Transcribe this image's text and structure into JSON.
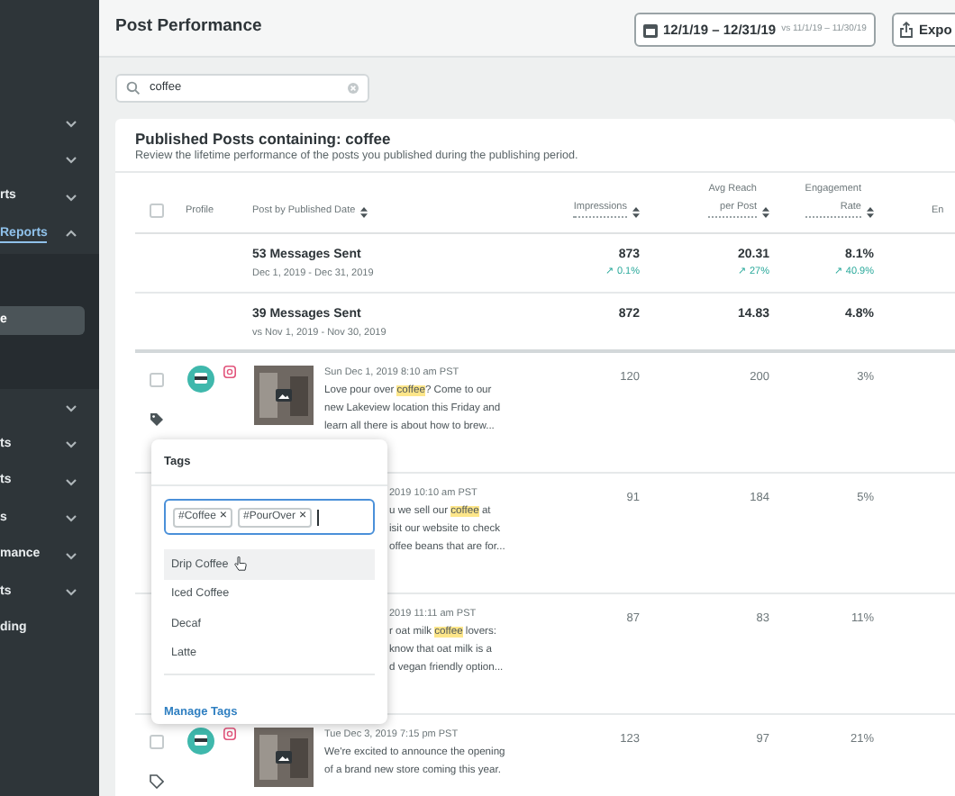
{
  "sidebar": {
    "items": [
      {
        "expanded": false
      },
      {
        "expanded": false
      },
      {
        "label": "rts",
        "expanded": false
      },
      {
        "label": "Reports",
        "expanded": true,
        "children": [
          {
            "label": "e",
            "selected": true
          }
        ]
      },
      {
        "expanded": false
      },
      {
        "label": "ts",
        "expanded": false
      },
      {
        "label": "ts",
        "expanded": false
      },
      {
        "label": "s",
        "expanded": false
      },
      {
        "label": "mance",
        "expanded": false
      },
      {
        "label": "ts",
        "expanded": false
      },
      {
        "label": "ding"
      }
    ]
  },
  "header": {
    "title": "Post Performance",
    "date_range": {
      "range": "12/1/19 – 12/31/19",
      "compare": "vs 11/1/19 – 11/30/19"
    },
    "export_button": "Expo"
  },
  "search": {
    "value": "coffee"
  },
  "card": {
    "title": "Published Posts containing: coffee",
    "subtitle": "Review the lifetime performance of the posts you published during the publishing period."
  },
  "table": {
    "select_all": {
      "checked": false
    },
    "columns": [
      "Profile",
      "Post by Published Date",
      "Impressions",
      "Avg Reach\nper Post",
      "Engagement\nRate",
      "En"
    ],
    "summary_rows": [
      {
        "title": "53 Messages Sent",
        "dates": "Dec 1, 2019 - Dec 31, 2019",
        "values": [
          {
            "value": "873",
            "change": "↗ 0.1%"
          },
          {
            "value": "20.31",
            "change": "↗ 27%"
          },
          {
            "value": "8.1%",
            "change": "↗ 40.9%"
          }
        ]
      },
      {
        "title": "39 Messages Sent",
        "dates": "vs Nov 1, 2019 - Nov 30, 2019",
        "values": [
          {
            "value": "872"
          },
          {
            "value": "14.83"
          },
          {
            "value": "4.8%"
          }
        ]
      }
    ],
    "rows": [
      {
        "kind": "full",
        "checked": false,
        "tagged": true,
        "date": "Sun Dec 1, 2019 8:10 am PST",
        "body": [
          {
            "text": "Love pour over ",
            "highlighted": false
          },
          {
            "text": "coffee",
            "highlighted": true
          },
          {
            "text": "? Come to our\nnew Lakeview location this Friday and\nlearn all there is about how to brew...",
            "highlighted": false
          }
        ],
        "values": [
          "120",
          "200",
          "3%"
        ]
      },
      {
        "kind": "covered",
        "date": "2019 10:10 am PST",
        "body": [
          {
            "text": "u we sell our ",
            "highlighted": false
          },
          {
            "text": "coffee",
            "highlighted": true
          },
          {
            "text": " at\nisit our website to check\noffee beans that are for...",
            "highlighted": false
          }
        ],
        "values": [
          "91",
          "184",
          "5%"
        ]
      },
      {
        "kind": "covered",
        "date": "2019 11:11 am PST",
        "body": [
          {
            "text": "r oat milk ",
            "highlighted": false
          },
          {
            "text": "coffee",
            "highlighted": true
          },
          {
            "text": " lovers:\nknow that oat milk is a\nd vegan friendly option...",
            "highlighted": false
          }
        ],
        "values": [
          "87",
          "83",
          "11%"
        ]
      },
      {
        "kind": "full",
        "checked": false,
        "tagged": false,
        "date": "Tue Dec 3, 2019 7:15 pm PST",
        "body": [
          {
            "text": "We're excited to announce the opening\nof a brand new store coming this year.",
            "highlighted": false
          }
        ],
        "values": [
          "123",
          "97",
          "21%"
        ]
      }
    ]
  },
  "tags_popup": {
    "title": "Tags",
    "chips": [
      "#Coffee",
      "#PourOver"
    ],
    "chip_remove": "×",
    "options": [
      {
        "label": "Drip Coffee",
        "selected": true
      },
      {
        "label": "Iced Coffee",
        "selected": false
      },
      {
        "label": "Decaf",
        "selected": false
      },
      {
        "label": "Latte",
        "selected": false
      }
    ],
    "link": "Manage Tags"
  }
}
